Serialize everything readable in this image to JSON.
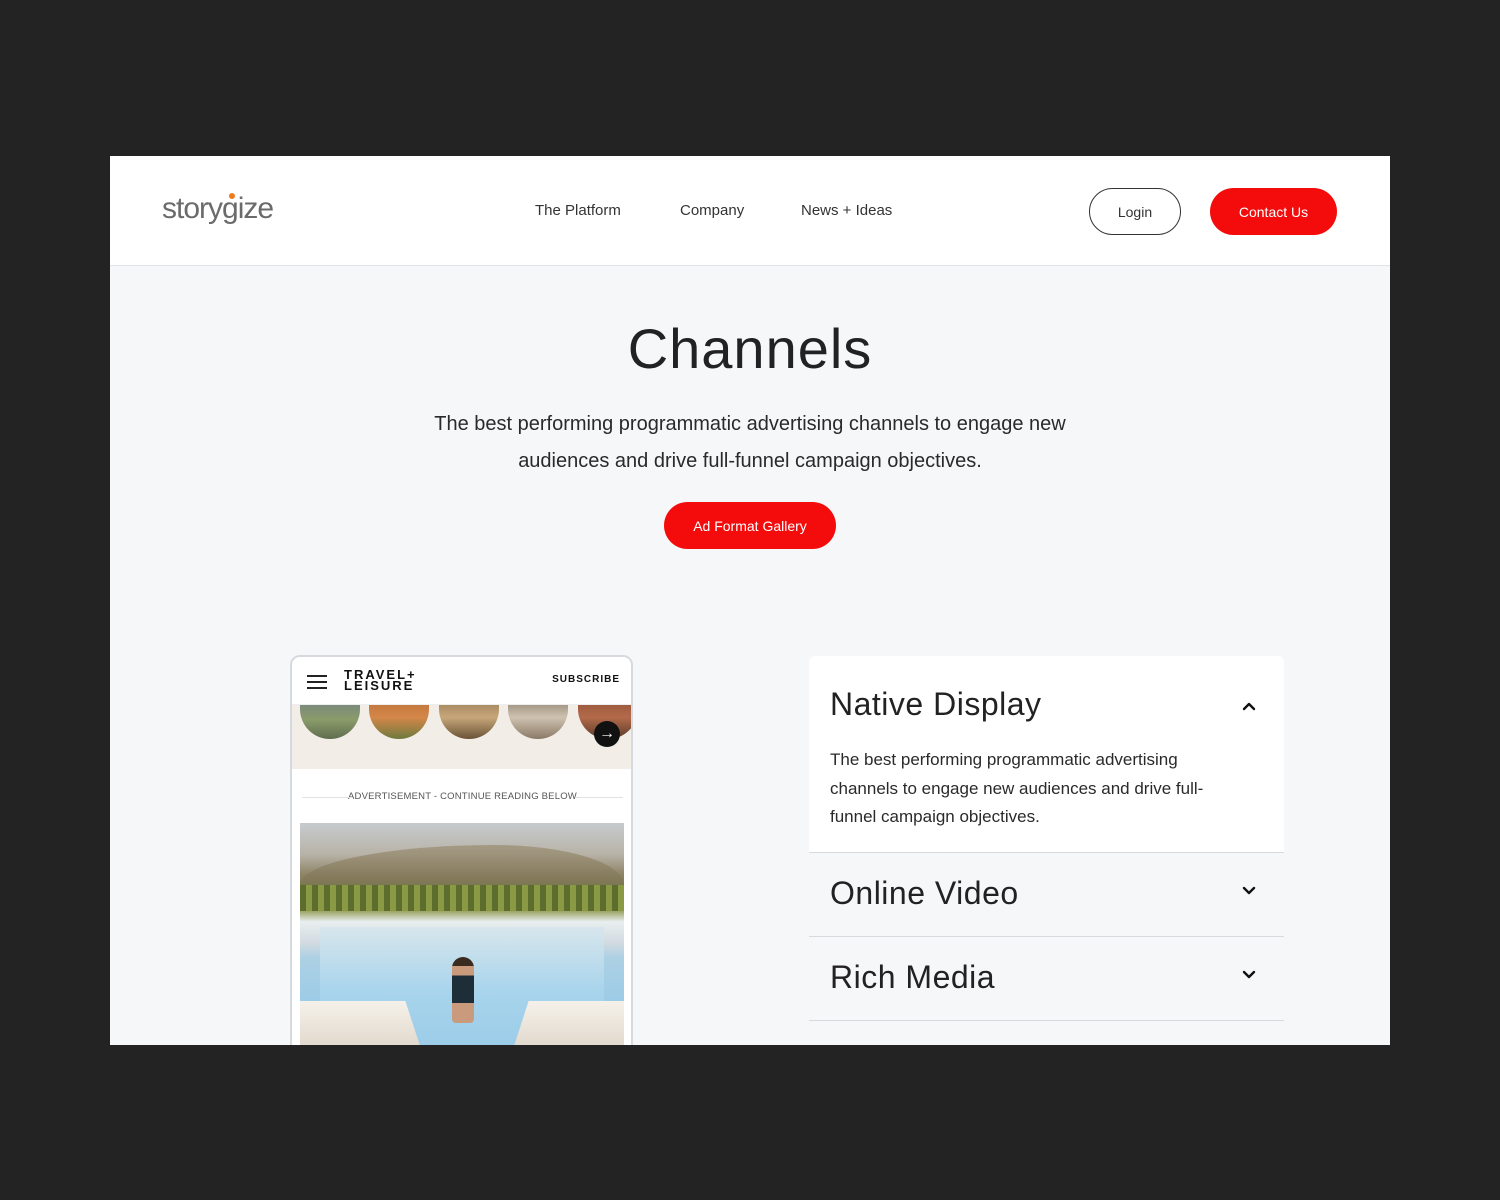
{
  "header": {
    "logo": "storygize",
    "nav": [
      "The Platform",
      "Company",
      "News + Ideas"
    ],
    "login_label": "Login",
    "contact_label": "Contact Us"
  },
  "hero": {
    "title": "Channels",
    "subtitle": "The best performing programmatic advertising channels to engage new audiences and drive full-funnel campaign objectives.",
    "gallery_label": "Ad Format Gallery"
  },
  "phone": {
    "brand_line1": "TRAVEL+",
    "brand_line2": "LEISURE",
    "subscribe_label": "SUBSCRIBE",
    "ad_label": "ADVERTISEMENT - CONTINUE READING BELOW"
  },
  "accordion": {
    "items": [
      {
        "title": "Native Display",
        "body": "The best performing programmatic advertising channels to engage new audiences and drive full-funnel campaign objectives.",
        "expanded": true
      },
      {
        "title": "Online Video",
        "expanded": false
      },
      {
        "title": "Rich Media",
        "expanded": false
      }
    ]
  },
  "colors": {
    "accent": "#f40c0c",
    "logo_dot": "#f07b1d",
    "page_bg": "#232323",
    "content_bg": "#f6f7f9"
  }
}
